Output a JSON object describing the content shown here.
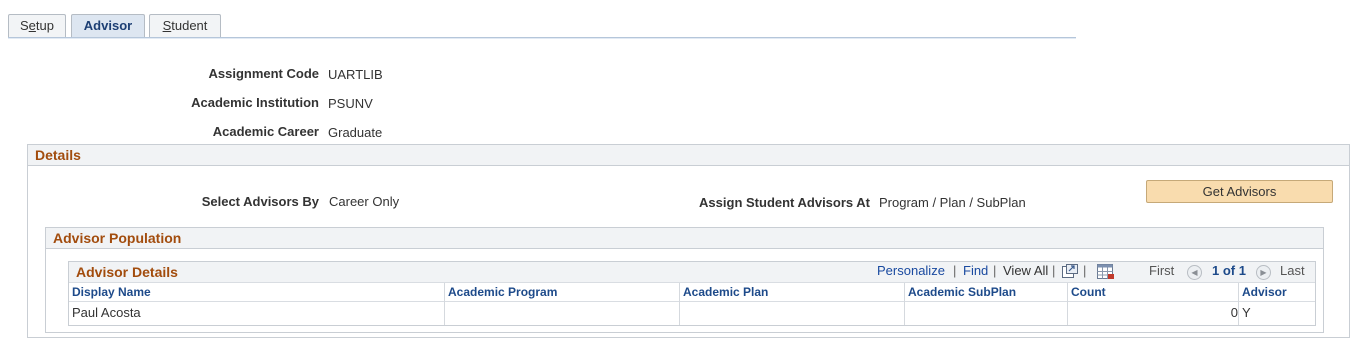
{
  "tabs": [
    {
      "label": "Setup",
      "active": false
    },
    {
      "label": "Advisor",
      "active": true
    },
    {
      "label": "Student",
      "active": false
    }
  ],
  "header": {
    "assignment_code": {
      "label": "Assignment Code",
      "value": "UARTLIB"
    },
    "academic_institution": {
      "label": "Academic Institution",
      "value": "PSUNV"
    },
    "academic_career": {
      "label": "Academic Career",
      "value": "Graduate"
    }
  },
  "details": {
    "title": "Details",
    "select_advisors_by": {
      "label": "Select Advisors By",
      "value": "Career Only"
    },
    "assign_student_advisors_at": {
      "label": "Assign Student Advisors At",
      "value": "Program / Plan / SubPlan"
    },
    "get_advisors_button": "Get Advisors"
  },
  "population": {
    "title": "Advisor Population",
    "grid": {
      "title": "Advisor Details",
      "toolbar": {
        "personalize": "Personalize",
        "find": "Find",
        "view_all": "View All",
        "first": "First",
        "pager": "1 of 1",
        "last": "Last",
        "separator": "|"
      },
      "columns": [
        "Display Name",
        "Academic Program",
        "Academic Plan",
        "Academic SubPlan",
        "Count",
        "Advisor"
      ],
      "rows": [
        {
          "display_name": "Paul Acosta",
          "academic_program": "",
          "academic_plan": "",
          "academic_subplan": "",
          "count": "0",
          "advisor": "Y"
        }
      ]
    }
  },
  "icons": {
    "zoom": "new-window-icon",
    "download": "spreadsheet-download-icon",
    "prev": "left-arrow-icon",
    "next": "right-arrow-icon"
  },
  "colors": {
    "section_title": "#a24c0d",
    "link": "#1a4aa0",
    "button_bg": "#f9dcae",
    "active_tab_bg": "#dde6f1"
  }
}
